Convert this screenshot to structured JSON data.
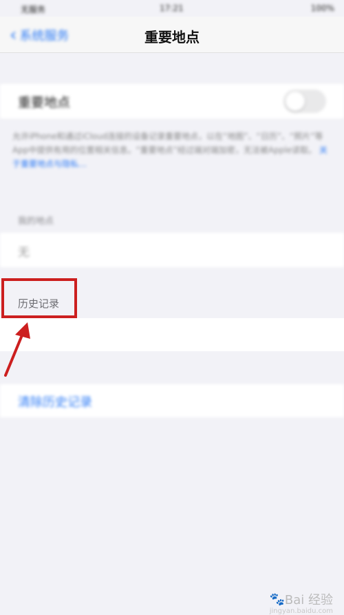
{
  "status_bar": {
    "carrier": "无服务",
    "time": "17:21",
    "battery": "100%"
  },
  "navbar": {
    "back_label": "系统服务",
    "title": "重要地点"
  },
  "toggle_row": {
    "label": "重要地点",
    "enabled": false
  },
  "description": {
    "text": "允许iPhone和通过iCloud连接的设备记录重要地点，以在“地图”、“日历”、“照片”等App中提供有用的位置相关信息。“重要地点”经过端对端加密，无法被Apple读取。",
    "link": "关于重要地点与隐私…"
  },
  "my_places": {
    "header": "我的地点",
    "value": "无"
  },
  "history": {
    "header": "历史记录"
  },
  "clear_history": {
    "label": "清除历史记录"
  },
  "watermark": {
    "text": "Bai 经验",
    "sub": "jingyan.baidu.com"
  },
  "colors": {
    "accent": "#2f7cf6",
    "highlight": "#cc1f1f",
    "background": "#f2f2f7"
  }
}
